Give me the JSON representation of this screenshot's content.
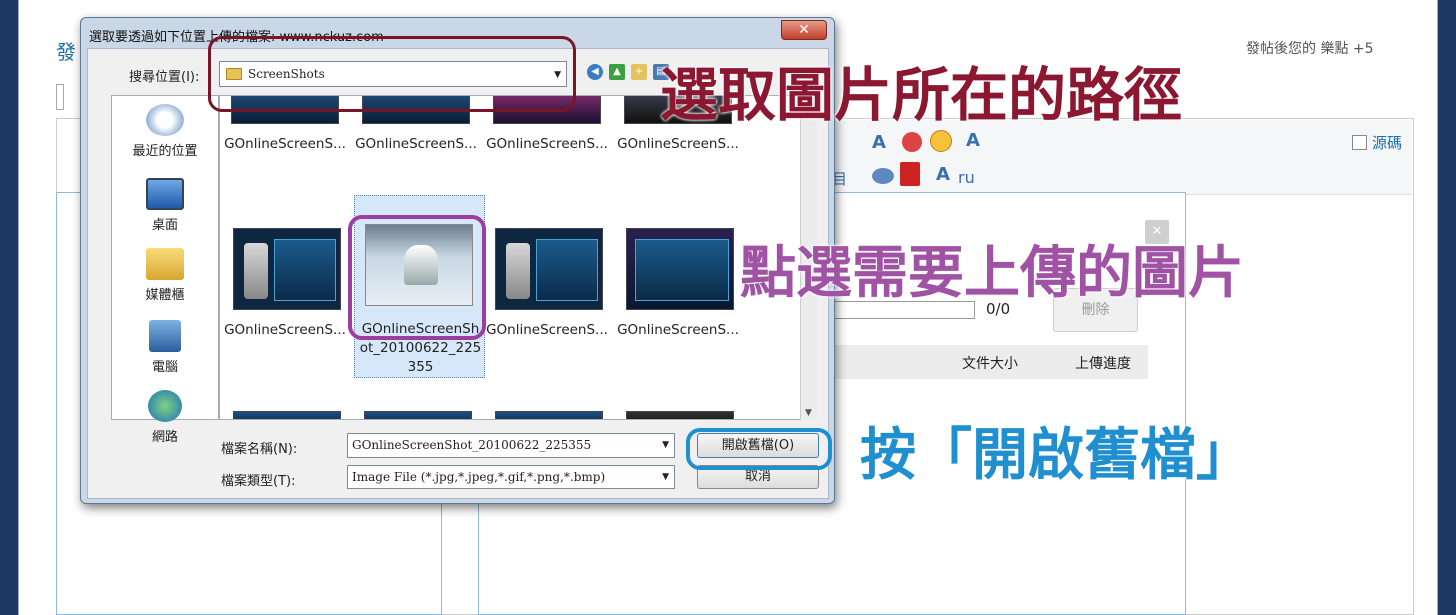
{
  "background": {
    "title_partial": "發",
    "bonus_text": "發帖後您的 樂點 +5",
    "source_label": "源碼",
    "toolbar_icons": [
      "A",
      "A",
      "ru"
    ],
    "progress_count": "0/0",
    "delete_button": "刪除",
    "column_file_size": "文件大小",
    "column_upload_progress": "上傳進度",
    "partial_label": "目"
  },
  "dialog": {
    "title": "選取要透過如下位置上傳的檔案: www.nckuz.com",
    "close_label": "✕",
    "look_in_label": "搜尋位置(I):",
    "look_in_value": "ScreenShots",
    "places": [
      "最近的位置",
      "桌面",
      "媒體櫃",
      "電腦",
      "網路"
    ],
    "files_row1": [
      "GOnlineScreenS...",
      "GOnlineScreenS...",
      "GOnlineScreenS...",
      "GOnlineScreenS..."
    ],
    "files_row2_left": "GOnlineScreenS...",
    "selected_file_line1": "GOnlineScreenSh",
    "selected_file_line2": "ot_20100622_225",
    "selected_file_line3": "355",
    "files_row2_right": [
      "GOnlineScreenS...",
      "GOnlineScreenS..."
    ],
    "file_name_label": "檔案名稱(N):",
    "file_name_value": "GOnlineScreenShot_20100622_225355",
    "file_type_label": "檔案類型(T):",
    "file_type_value": "Image File (*.jpg,*.jpeg,*.gif,*.png,*.bmp)",
    "open_button": "開啟舊檔(O)",
    "cancel_button": "取消"
  },
  "annotations": {
    "step1": "選取圖片所在的路徑",
    "step2": "點選需要上傳的圖片",
    "step3": "按「開啟舊檔」"
  },
  "colors": {
    "step1": "#8b1830",
    "step2": "#a052a4",
    "step3": "#1f8fd0"
  }
}
